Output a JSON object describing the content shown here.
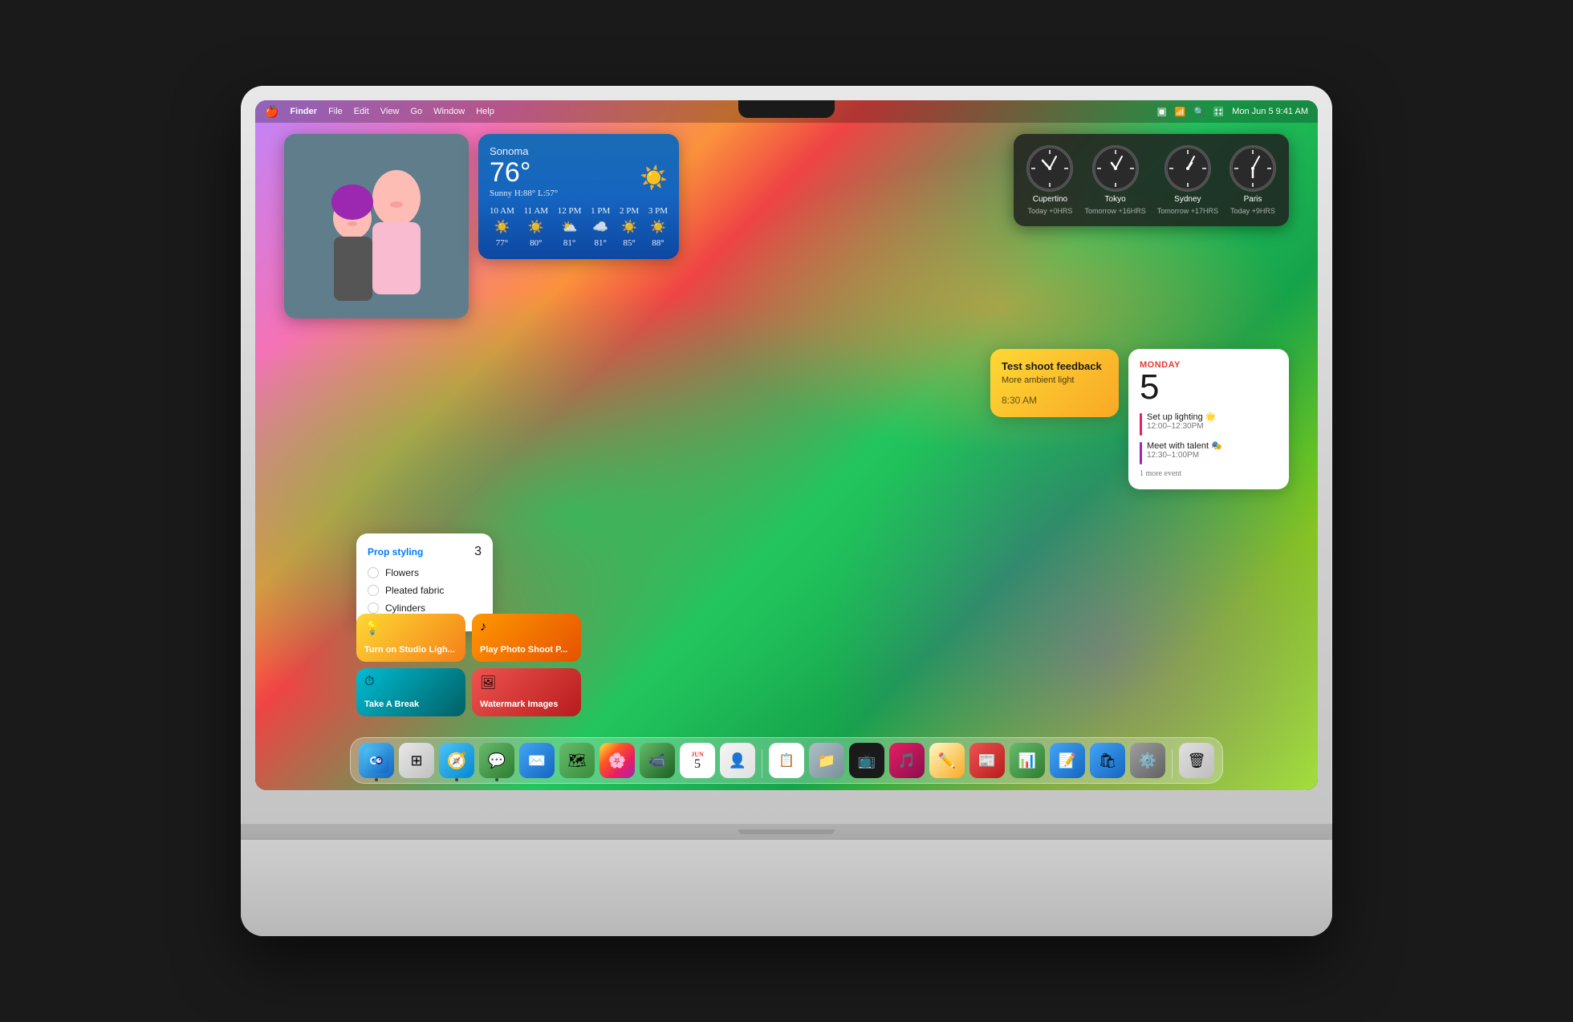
{
  "menubar": {
    "apple": "🍎",
    "finder": "Finder",
    "file": "File",
    "edit": "Edit",
    "view": "View",
    "go": "Go",
    "window": "Window",
    "help": "Help",
    "datetime": "Mon Jun 5  9:41 AM"
  },
  "weather": {
    "city": "Sonoma",
    "temp": "76°",
    "condition": "Sunny",
    "high_low": "H:88° L:57°",
    "hours": [
      {
        "time": "10 AM",
        "icon": "☀️",
        "temp": "77°"
      },
      {
        "time": "11 AM",
        "icon": "☀️",
        "temp": "80°"
      },
      {
        "time": "12 PM",
        "icon": "⛅",
        "temp": "81°"
      },
      {
        "time": "1 PM",
        "icon": "☁️",
        "temp": "81°"
      },
      {
        "time": "2 PM",
        "icon": "☀️",
        "temp": "85°"
      },
      {
        "time": "3 PM",
        "icon": "☀️",
        "temp": "88°"
      }
    ]
  },
  "clocks": [
    {
      "city": "Cupertino",
      "offset": "Today +0HRS",
      "hour_hand": 0,
      "minute_hand": 0
    },
    {
      "city": "Tokyo",
      "offset": "Tomorrow +16HRS",
      "hour_hand": 0,
      "minute_hand": 0
    },
    {
      "city": "Sydney",
      "offset": "Tomorrow +17HRS",
      "hour_hand": 0,
      "minute_hand": 0
    },
    {
      "city": "Paris",
      "offset": "Today +9HRS",
      "hour_hand": 0,
      "minute_hand": 0
    }
  ],
  "calendar": {
    "day_label": "Monday",
    "date": "5",
    "events": [
      {
        "title": "Set up lighting 🌟",
        "time": "12:00–12:30PM",
        "color": "pink"
      },
      {
        "title": "Meet with talent 🎭",
        "time": "12:30–1:00PM",
        "color": "purple"
      }
    ],
    "more": "1 more event"
  },
  "note": {
    "title": "Test shoot feedback",
    "subtitle": "More ambient light",
    "time": "8:30 AM"
  },
  "reminders": {
    "title": "Prop styling",
    "count": "3",
    "items": [
      {
        "label": "Flowers"
      },
      {
        "label": "Pleated fabric"
      },
      {
        "label": "Cylinders"
      }
    ]
  },
  "shortcuts": [
    {
      "label": "Turn on Studio Ligh...",
      "icon": "💡",
      "color": "yellow"
    },
    {
      "label": "Play Photo Shoot P...",
      "icon": "♪",
      "color": "orange"
    },
    {
      "label": "Take A Break",
      "icon": "⏱",
      "color": "teal"
    },
    {
      "label": "Watermark Images",
      "icon": "🖼",
      "color": "red"
    }
  ],
  "dock": [
    {
      "name": "Finder",
      "icon": "🔵",
      "class": "finder",
      "dot": true
    },
    {
      "name": "Launchpad",
      "icon": "⊞",
      "class": "launchpad"
    },
    {
      "name": "Safari",
      "icon": "🧭",
      "class": "safari",
      "dot": true
    },
    {
      "name": "Messages",
      "icon": "💬",
      "class": "messages",
      "dot": true
    },
    {
      "name": "Mail",
      "icon": "✉️",
      "class": "mail"
    },
    {
      "name": "Maps",
      "icon": "🗺",
      "class": "maps"
    },
    {
      "name": "Photos",
      "icon": "📷",
      "class": "photos"
    },
    {
      "name": "FaceTime",
      "icon": "📹",
      "class": "facetime"
    },
    {
      "name": "Calendar",
      "icon": "5",
      "class": "calendar"
    },
    {
      "name": "Contacts",
      "icon": "👤",
      "class": "contacts"
    },
    {
      "name": "Reminders",
      "icon": "📋",
      "class": "reminders"
    },
    {
      "name": "Files",
      "icon": "📁",
      "class": "files"
    },
    {
      "name": "Apple TV",
      "icon": "📺",
      "class": "appletv"
    },
    {
      "name": "Music",
      "icon": "♪",
      "class": "music"
    },
    {
      "name": "Freeform",
      "icon": "✏️",
      "class": "freeform"
    },
    {
      "name": "News",
      "icon": "📰",
      "class": "news"
    },
    {
      "name": "Numbers",
      "icon": "📊",
      "class": "bars"
    },
    {
      "name": "Xcode",
      "icon": "⚙️",
      "class": "xcode"
    },
    {
      "name": "App Store",
      "icon": "🛍",
      "class": "appstore"
    },
    {
      "name": "System Preferences",
      "icon": "⚙️",
      "class": "settings"
    },
    {
      "name": "Trash",
      "icon": "🗑",
      "class": "trash"
    }
  ]
}
